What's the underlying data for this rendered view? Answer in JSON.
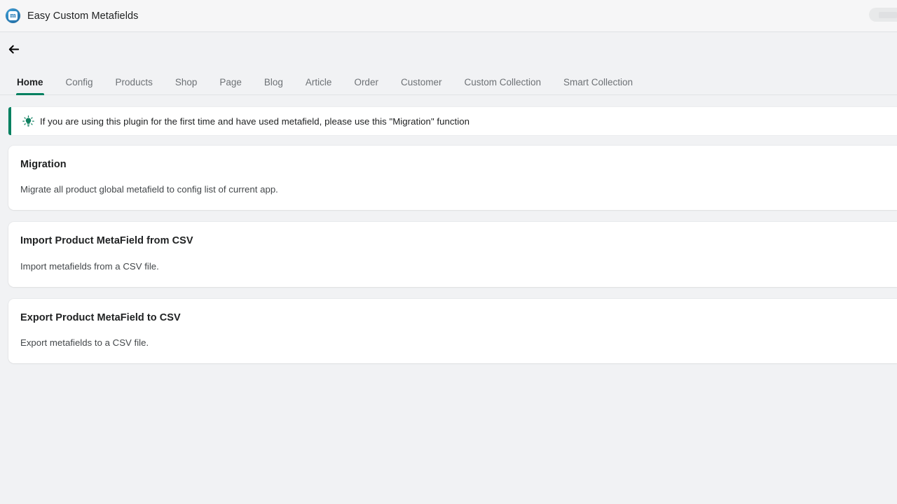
{
  "app_bar": {
    "title": "Easy Custom Metafields",
    "logo_letter": "m",
    "logo_icon": "app-logo-icon",
    "skeleton_label": ""
  },
  "navigation": {
    "back_icon": "arrow-left-icon",
    "tabs": [
      {
        "label": "Home",
        "active": true
      },
      {
        "label": "Config",
        "active": false
      },
      {
        "label": "Products",
        "active": false
      },
      {
        "label": "Shop",
        "active": false
      },
      {
        "label": "Page",
        "active": false
      },
      {
        "label": "Blog",
        "active": false
      },
      {
        "label": "Article",
        "active": false
      },
      {
        "label": "Order",
        "active": false
      },
      {
        "label": "Customer",
        "active": false
      },
      {
        "label": "Custom Collection",
        "active": false
      },
      {
        "label": "Smart Collection",
        "active": false
      }
    ]
  },
  "banner": {
    "icon": "lightbulb-icon",
    "text": "If you are using this plugin for the first time and have used metafield, please use this \"Migration\" function"
  },
  "cards": [
    {
      "title": "Migration",
      "body": "Migrate all product global metafield to config list of current app."
    },
    {
      "title": "Import Product MetaField from CSV",
      "body": "Import metafields from a CSV file."
    },
    {
      "title": "Export Product MetaField to CSV",
      "body": "Export metafields to a CSV file."
    }
  ],
  "colors": {
    "accent_green": "#008060",
    "page_background": "#f1f2f4",
    "app_bar_background": "#f6f6f7",
    "card_background": "#ffffff",
    "text_primary": "#202223",
    "text_secondary": "#6d7175",
    "logo_blue": "#2279b5"
  }
}
